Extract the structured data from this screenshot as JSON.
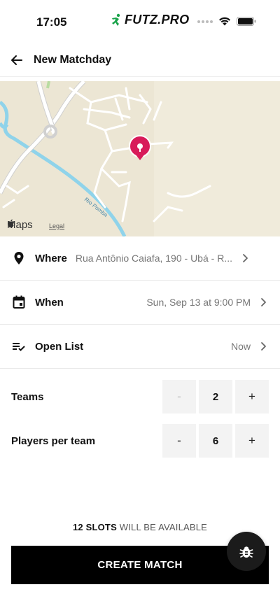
{
  "status_bar": {
    "time": "17:05",
    "brand": "FUTZ.PRO",
    "brand_color": "#1aa34a"
  },
  "header": {
    "title": "New Matchday",
    "back_icon": "arrow-left-icon"
  },
  "map": {
    "provider_label": "Maps",
    "legal_label": "Legal",
    "road_label": "Rio Pomba",
    "pin_color": "#d81b5a"
  },
  "rows": {
    "where": {
      "label": "Where",
      "value": "Rua Antônio Caiafa, 190 - Ubá - R...",
      "icon": "location-pin-icon"
    },
    "when": {
      "label": "When",
      "value": "Sun, Sep 13 at 9:00 PM",
      "icon": "calendar-icon"
    },
    "open_list": {
      "label": "Open List",
      "value": "Now",
      "icon": "list-check-icon"
    }
  },
  "steppers": {
    "teams": {
      "label": "Teams",
      "value": "2",
      "minus": "-",
      "plus": "+"
    },
    "players": {
      "label": "Players per team",
      "value": "6",
      "minus": "-",
      "plus": "+"
    }
  },
  "footer": {
    "slots_count": "12 SLOTS",
    "slots_text": " WILL BE AVAILABLE",
    "create_label": "CREATE MATCH",
    "fab_icon": "bug-icon"
  }
}
